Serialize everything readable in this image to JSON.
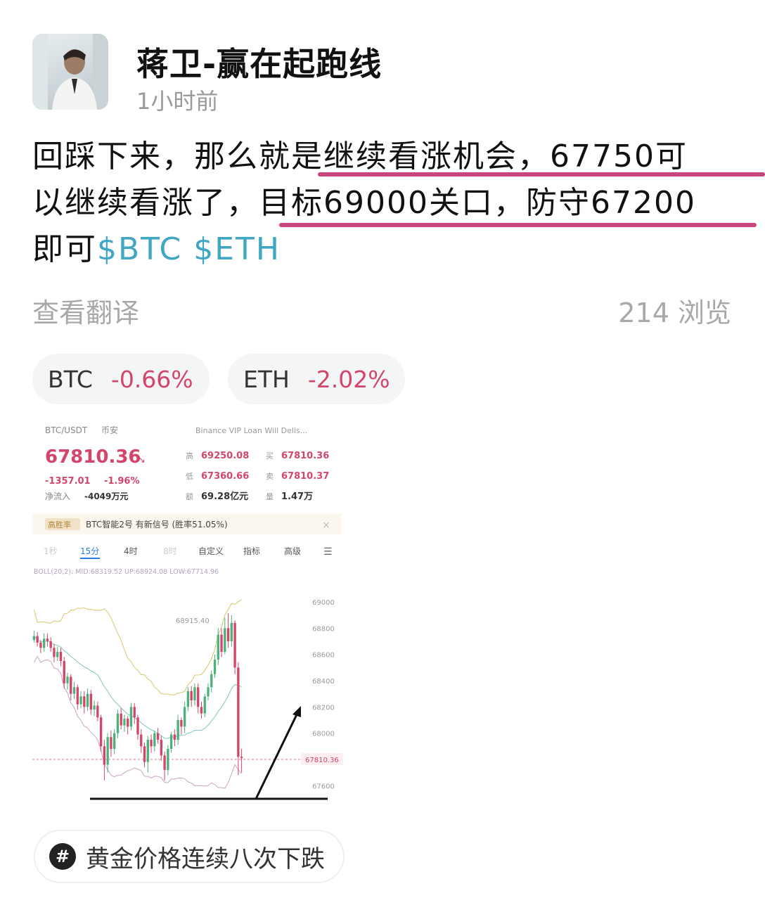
{
  "post": {
    "author": "蒋卫-赢在起跑线",
    "time": "1小时前",
    "text_lines": [
      "回踩下来，那么就是继续看涨机会，67750可",
      "以继续看涨了，目标69000关口，防守67200",
      "即可"
    ],
    "tags": [
      "$BTC",
      "$ETH"
    ],
    "translate_label": "查看翻译",
    "views": "214 浏览"
  },
  "tickers": [
    {
      "symbol": "BTC",
      "change": "-0.66%"
    },
    {
      "symbol": "ETH",
      "change": "-2.02%"
    }
  ],
  "topic": {
    "icon": "hash-icon",
    "label": "黄金价格连续八次下跌"
  },
  "colors": {
    "underline": "#c8467a",
    "tag": "#3fa6c3",
    "negative": "#d4456a"
  },
  "screenshot": {
    "pair": "BTC/USDT",
    "exchange": "币安",
    "notice": "Binance VIP Loan Will Delis...",
    "price": "67810.36",
    "change_abs": "-1357.01",
    "change_pct": "-1.96%",
    "netflow_label": "净流入",
    "netflow_value": "-4049万元",
    "stats": [
      {
        "label": "高",
        "value": "69250.08"
      },
      {
        "label": "买",
        "value": "67810.36"
      },
      {
        "label": "低",
        "value": "67360.66"
      },
      {
        "label": "卖",
        "value": "67810.37"
      },
      {
        "label": "额",
        "value": "69.28亿元"
      },
      {
        "label": "量",
        "value": "1.47万"
      }
    ],
    "signal_badge": "高胜率",
    "signal_text": "BTC智能2号 有新信号 (胜率51.05%)",
    "intervals": [
      "1秒",
      "15分",
      "4时",
      "8时",
      "自定义",
      "指标",
      "高级"
    ],
    "active_interval": "15分",
    "indicator": "BOLL(20,2): MID:68319.52 UP:68924.08 LOW:67714.96"
  },
  "chart_data": {
    "type": "candlestick",
    "yticks": [
      "69000",
      "68800",
      "68600",
      "68400",
      "68200",
      "68000",
      "67600"
    ],
    "ylim": [
      67500,
      69150
    ],
    "high_label": "68915.40",
    "last_price_label": "67810.36",
    "candles": [
      [
        68710,
        68740,
        68690,
        68780
      ],
      [
        68740,
        68690,
        68660,
        68770
      ],
      [
        68690,
        68650,
        68610,
        68710
      ],
      [
        68650,
        68720,
        68620,
        68760
      ],
      [
        68720,
        68700,
        68660,
        68760
      ],
      [
        68700,
        68650,
        68620,
        68730
      ],
      [
        68650,
        68580,
        68540,
        68680
      ],
      [
        68580,
        68620,
        68550,
        68660
      ],
      [
        68620,
        68550,
        68510,
        68650
      ],
      [
        68550,
        68380,
        68340,
        68580
      ],
      [
        68380,
        68430,
        68330,
        68460
      ],
      [
        68430,
        68300,
        68250,
        68450
      ],
      [
        68300,
        68350,
        68260,
        68390
      ],
      [
        68350,
        68220,
        68180,
        68370
      ],
      [
        68220,
        68280,
        68190,
        68320
      ],
      [
        68280,
        68200,
        68150,
        68320
      ],
      [
        68200,
        68300,
        68170,
        68340
      ],
      [
        68300,
        68180,
        68140,
        68330
      ],
      [
        68180,
        68210,
        68130,
        68250
      ],
      [
        68210,
        68120,
        68090,
        68240
      ],
      [
        68120,
        67900,
        67860,
        68140
      ],
      [
        67900,
        67760,
        67640,
        67950
      ],
      [
        67760,
        67970,
        67700,
        68000
      ],
      [
        67970,
        67880,
        67820,
        68020
      ],
      [
        67880,
        68000,
        67840,
        68030
      ],
      [
        68000,
        68150,
        67960,
        68180
      ],
      [
        68150,
        68060,
        68030,
        68190
      ],
      [
        68060,
        68110,
        68010,
        68140
      ],
      [
        68110,
        68050,
        67990,
        68130
      ],
      [
        68050,
        68200,
        68020,
        68230
      ],
      [
        68200,
        68120,
        68070,
        68230
      ],
      [
        68120,
        67990,
        67950,
        68140
      ],
      [
        67990,
        67900,
        67850,
        68030
      ],
      [
        67900,
        67780,
        67740,
        67930
      ],
      [
        67780,
        67950,
        67700,
        67980
      ],
      [
        67950,
        67900,
        67850,
        67990
      ],
      [
        67900,
        68000,
        67860,
        68020
      ],
      [
        68000,
        67950,
        67920,
        68040
      ],
      [
        67950,
        67830,
        67790,
        67980
      ],
      [
        67830,
        67720,
        67640,
        67860
      ],
      [
        67720,
        67880,
        67680,
        67910
      ],
      [
        67880,
        67990,
        67850,
        68010
      ],
      [
        67990,
        67950,
        67900,
        68030
      ],
      [
        67950,
        68100,
        67910,
        68140
      ],
      [
        68100,
        68050,
        67990,
        68120
      ],
      [
        68050,
        68200,
        68000,
        68240
      ],
      [
        68200,
        68320,
        68170,
        68350
      ],
      [
        68320,
        68250,
        68200,
        68360
      ],
      [
        68250,
        68350,
        68210,
        68380
      ],
      [
        68350,
        68200,
        68150,
        68380
      ],
      [
        68200,
        68150,
        68110,
        68240
      ],
      [
        68150,
        68280,
        68120,
        68300
      ],
      [
        68280,
        68350,
        68250,
        68380
      ],
      [
        68350,
        68450,
        68310,
        68480
      ],
      [
        68450,
        68560,
        68420,
        68600
      ],
      [
        68560,
        68750,
        68520,
        68800
      ],
      [
        68750,
        68620,
        68580,
        68800
      ],
      [
        68620,
        68800,
        68600,
        68880
      ],
      [
        68800,
        68700,
        68650,
        68915
      ],
      [
        68700,
        68840,
        68660,
        68900
      ],
      [
        68840,
        68500,
        68450,
        68860
      ],
      [
        68500,
        67820,
        67680,
        68540
      ],
      [
        67820,
        67810,
        67700,
        67880
      ]
    ]
  }
}
